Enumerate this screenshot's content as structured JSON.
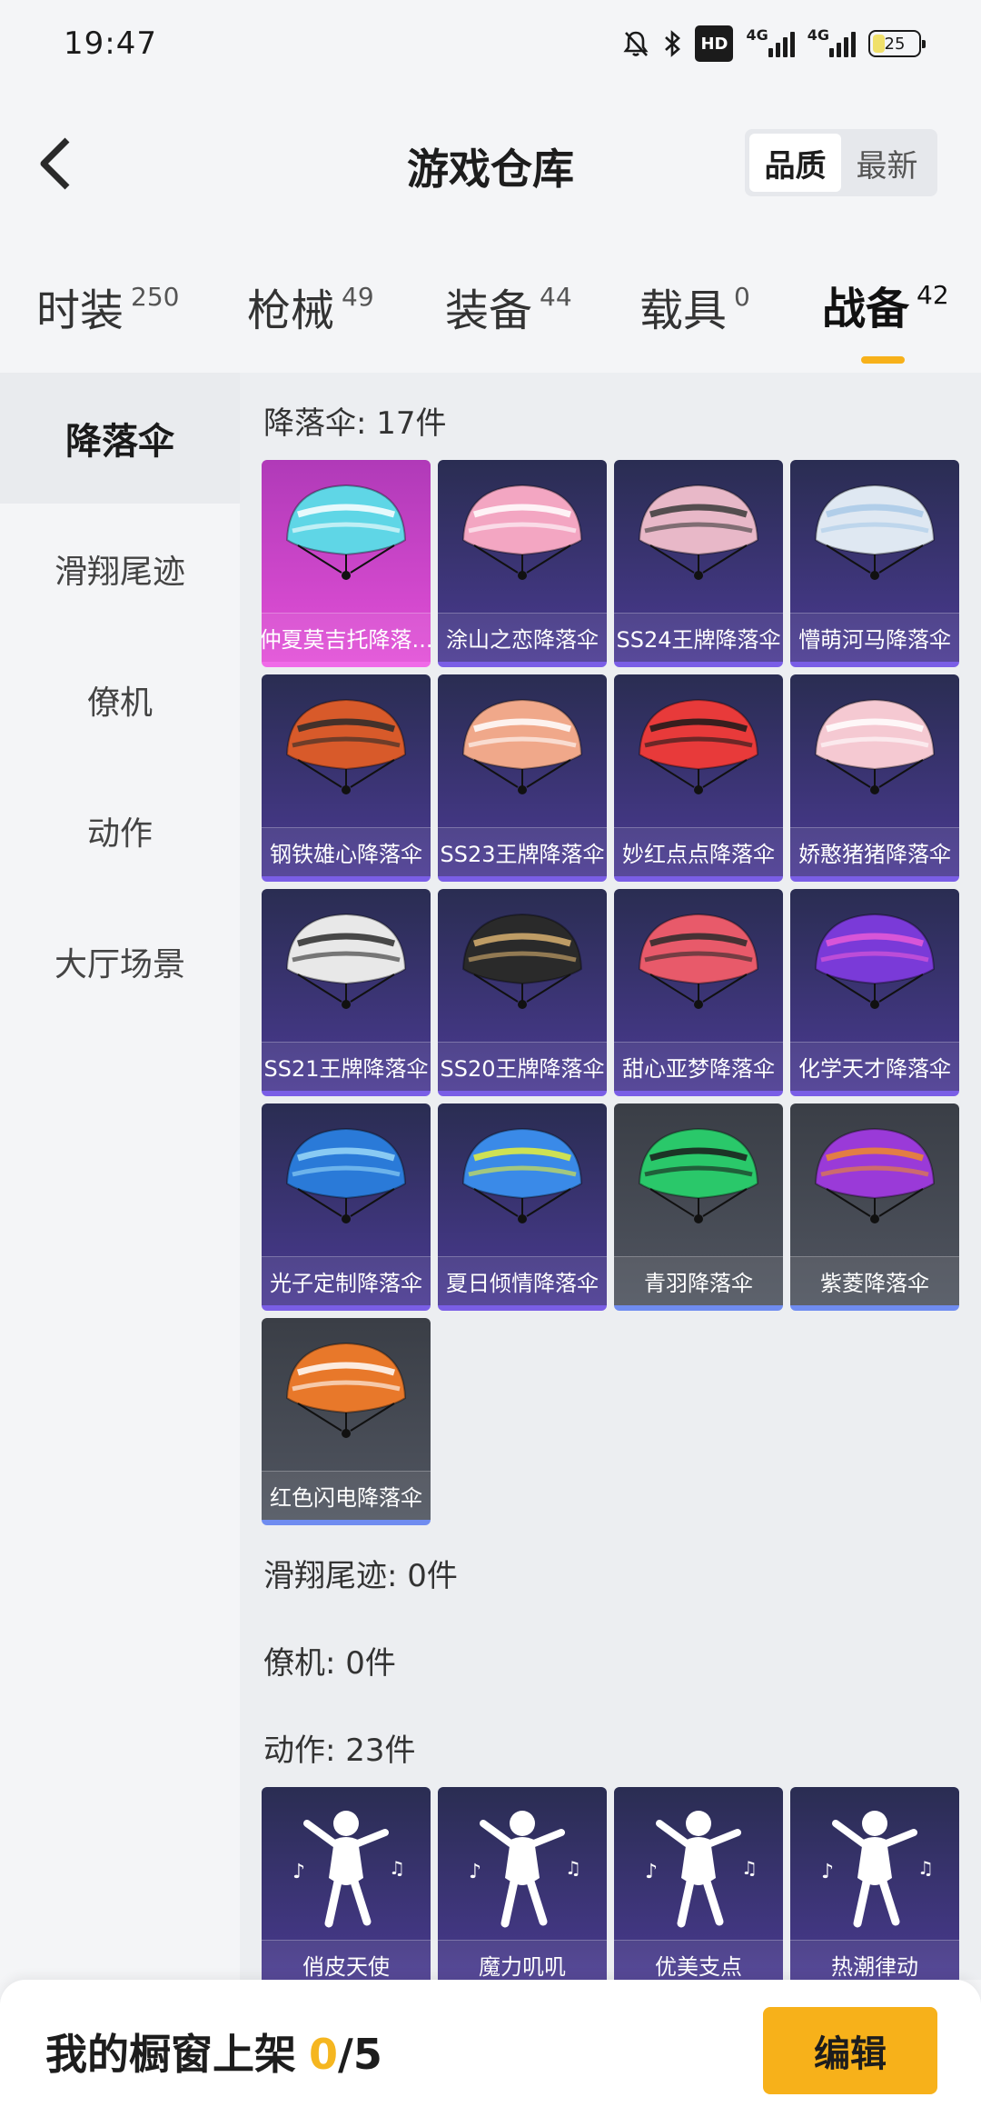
{
  "status": {
    "time": "19:47",
    "hd": "HD",
    "net1": "4G",
    "net2": "4G",
    "battery": "25"
  },
  "header": {
    "title": "游戏仓库",
    "sort_options": [
      "品质",
      "最新"
    ],
    "sort_active": "品质"
  },
  "categories": [
    {
      "label": "时装",
      "count": "250"
    },
    {
      "label": "枪械",
      "count": "49"
    },
    {
      "label": "装备",
      "count": "44"
    },
    {
      "label": "载具",
      "count": "0"
    },
    {
      "label": "战备",
      "count": "42",
      "active": true
    }
  ],
  "sidebar": {
    "items": [
      "降落伞",
      "滑翔尾迹",
      "僚机",
      "动作",
      "大厅场景"
    ],
    "active": "降落伞"
  },
  "sections": {
    "parachute": {
      "title": "降落伞: 17件",
      "items": [
        {
          "name": "仲夏莫吉托降落...",
          "tier": "rare",
          "colors": [
            "#5fd6e6",
            "#ffffff"
          ]
        },
        {
          "name": "涂山之恋降落伞",
          "tier": "epic",
          "colors": [
            "#f3a6c2",
            "#ffffff"
          ]
        },
        {
          "name": "SS24王牌降落伞",
          "tier": "epic",
          "colors": [
            "#e8b8c8",
            "#3a3a3a"
          ]
        },
        {
          "name": "懵萌河马降落伞",
          "tier": "epic",
          "colors": [
            "#dfe8f2",
            "#a9c9e8"
          ]
        },
        {
          "name": "钢铁雄心降落伞",
          "tier": "epic",
          "colors": [
            "#d85a2a",
            "#2a2a2a"
          ]
        },
        {
          "name": "SS23王牌降落伞",
          "tier": "epic",
          "colors": [
            "#f0a88a",
            "#ffffff"
          ]
        },
        {
          "name": "妙红点点降落伞",
          "tier": "epic",
          "colors": [
            "#e83a3a",
            "#1a1a1a"
          ]
        },
        {
          "name": "娇憨猪猪降落伞",
          "tier": "epic",
          "colors": [
            "#f5c9d2",
            "#ffffff"
          ]
        },
        {
          "name": "SS21王牌降落伞",
          "tier": "epic",
          "colors": [
            "#e8e8e8",
            "#2a2a2a"
          ]
        },
        {
          "name": "SS20王牌降落伞",
          "tier": "epic",
          "colors": [
            "#2a2a2a",
            "#d8b070"
          ]
        },
        {
          "name": "甜心亚梦降落伞",
          "tier": "epic",
          "colors": [
            "#e85a6a",
            "#2a2a2a"
          ]
        },
        {
          "name": "化学天才降落伞",
          "tier": "epic",
          "colors": [
            "#7a3ad8",
            "#e85ad8"
          ]
        },
        {
          "name": "光子定制降落伞",
          "tier": "epic",
          "colors": [
            "#2a7ad8",
            "#9ad8f8"
          ]
        },
        {
          "name": "夏日倾情降落伞",
          "tier": "epic",
          "colors": [
            "#3a8ae8",
            "#e8f03a"
          ]
        },
        {
          "name": "青羽降落伞",
          "tier": "gray",
          "colors": [
            "#2ac86a",
            "#1a1a1a"
          ]
        },
        {
          "name": "紫菱降落伞",
          "tier": "gray",
          "colors": [
            "#9a3ad8",
            "#f08a2a"
          ]
        },
        {
          "name": "红色闪电降落伞",
          "tier": "gray",
          "colors": [
            "#e8782a",
            "#ffffff"
          ]
        }
      ]
    },
    "trail": {
      "title": "滑翔尾迹: 0件"
    },
    "wingman": {
      "title": "僚机: 0件"
    },
    "emote": {
      "title": "动作: 23件",
      "items": [
        {
          "name": "俏皮天使"
        },
        {
          "name": "魔力叽叽"
        },
        {
          "name": "优美支点"
        },
        {
          "name": "热潮律动"
        }
      ]
    }
  },
  "bottom": {
    "label": "我的橱窗上架",
    "count": "0",
    "separator": "/",
    "total": "5",
    "edit_label": "编辑"
  }
}
